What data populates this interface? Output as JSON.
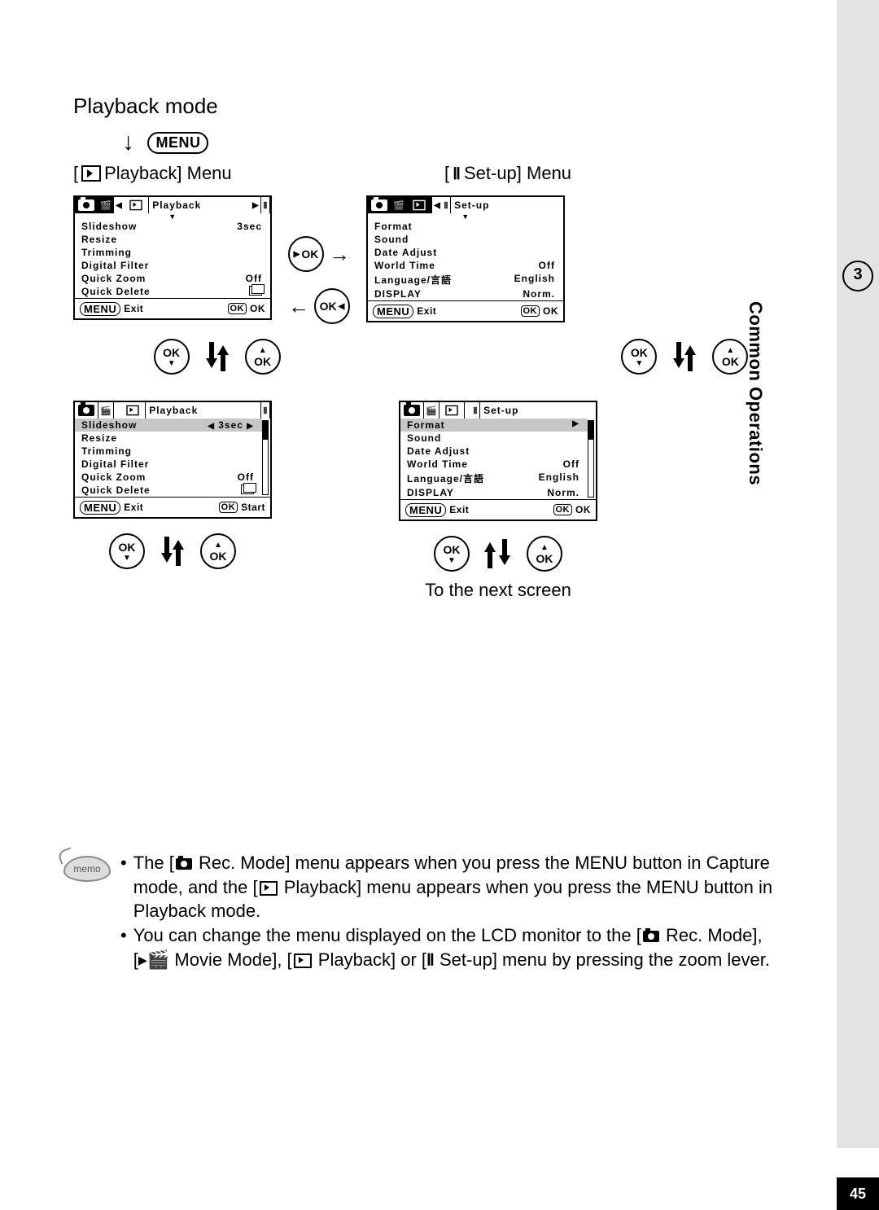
{
  "title": "Playback mode",
  "menu_button_label": "MENU",
  "columns": {
    "playback_label": "Playback] Menu",
    "setup_label": "Set-up] Menu"
  },
  "playback_screen_1": {
    "tab_title": "Playback",
    "rows": [
      {
        "label": "Slideshow",
        "value": "3sec"
      },
      {
        "label": "Resize",
        "value": ""
      },
      {
        "label": "Trimming",
        "value": ""
      },
      {
        "label": "Digital Filter",
        "value": ""
      },
      {
        "label": "Quick Zoom",
        "value": "Off"
      },
      {
        "label": "Quick Delete",
        "value": "□"
      }
    ],
    "footer_left": "Exit",
    "footer_right": "OK"
  },
  "playback_screen_2": {
    "tab_title": "Playback",
    "rows": [
      {
        "label": "Slideshow",
        "value": "3sec",
        "hl": true,
        "arrows": true
      },
      {
        "label": "Resize",
        "value": ""
      },
      {
        "label": "Trimming",
        "value": ""
      },
      {
        "label": "Digital Filter",
        "value": ""
      },
      {
        "label": "Quick Zoom",
        "value": "Off"
      },
      {
        "label": "Quick Delete",
        "value": "□"
      }
    ],
    "footer_left": "Exit",
    "footer_right": "Start"
  },
  "setup_screen_1": {
    "tab_title": "Set-up",
    "rows": [
      {
        "label": "Format",
        "value": ""
      },
      {
        "label": "Sound",
        "value": ""
      },
      {
        "label": "Date Adjust",
        "value": ""
      },
      {
        "label": "World Time",
        "value": "Off"
      },
      {
        "label": "Language/言語",
        "value": "English"
      },
      {
        "label": "DISPLAY",
        "value": "Norm."
      }
    ],
    "footer_left": "Exit",
    "footer_right": "OK"
  },
  "setup_screen_2": {
    "tab_title": "Set-up",
    "rows": [
      {
        "label": "Format",
        "value": "",
        "hl": true,
        "right_arrow": true
      },
      {
        "label": "Sound",
        "value": ""
      },
      {
        "label": "Date Adjust",
        "value": ""
      },
      {
        "label": "World Time",
        "value": "Off"
      },
      {
        "label": "Language/言語",
        "value": "English"
      },
      {
        "label": "DISPLAY",
        "value": "Norm."
      }
    ],
    "footer_left": "Exit",
    "footer_right": "OK"
  },
  "next_screen_label": "To the next screen",
  "ok_label": "OK",
  "memo_label": "memo",
  "memo_items": [
    "The [📷 Rec. Mode] menu appears when you press the MENU button in Capture mode, and the [▶ Playback] menu appears when you press the MENU button in Playback mode.",
    "You can change the menu displayed on the LCD monitor to the [📷 Rec. Mode], [🎬 Movie Mode], [▶ Playback] or [⚙ Set-up] menu by pressing the zoom lever."
  ],
  "section_number": "3",
  "section_title": "Common Operations",
  "page_number": "45"
}
